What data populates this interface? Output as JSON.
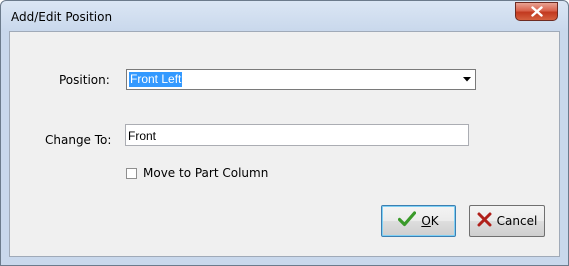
{
  "window": {
    "title": "Add/Edit Position"
  },
  "form": {
    "position_label": "Position:",
    "position_value": "Front Left",
    "change_to_label": "Change To:",
    "change_to_value": "Front",
    "move_to_part_column_label": "Move to Part Column",
    "move_to_part_column_checked": false
  },
  "buttons": {
    "ok_label_underlined": "O",
    "ok_label_rest": "K",
    "cancel_label": "Cancel"
  },
  "icons": {
    "close": "close-x-icon",
    "dropdown": "chevron-down-icon",
    "ok": "green-checkmark-icon",
    "cancel": "red-x-icon"
  },
  "colors": {
    "selection": "#3399ff",
    "close_button": "#c2391f",
    "ok_check": "#3a9a2a",
    "cancel_x": "#b0201a"
  }
}
